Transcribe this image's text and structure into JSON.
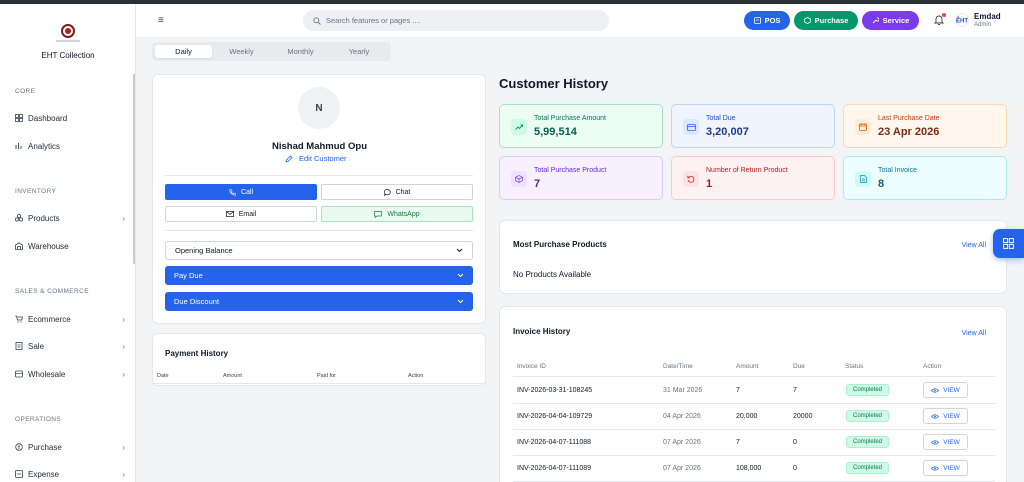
{
  "app": {
    "brand": "EHT Collection"
  },
  "sidebar": {
    "sections": [
      {
        "title": "CORE",
        "items": [
          {
            "label": "Dashboard",
            "icon": "dashboard-icon"
          },
          {
            "label": "Analytics",
            "icon": "analytics-icon"
          }
        ]
      },
      {
        "title": "INVENTORY",
        "items": [
          {
            "label": "Products",
            "icon": "products-icon",
            "expandable": true
          },
          {
            "label": "Warehouse",
            "icon": "warehouse-icon"
          }
        ]
      },
      {
        "title": "SALES & COMMERCE",
        "items": [
          {
            "label": "Ecommerce",
            "icon": "cart-icon",
            "expandable": true
          },
          {
            "label": "Sale",
            "icon": "sale-icon",
            "expandable": true
          },
          {
            "label": "Wholesale",
            "icon": "wholesale-icon",
            "expandable": true
          }
        ]
      },
      {
        "title": "OPERATIONS",
        "items": [
          {
            "label": "Purchase",
            "icon": "purchase-icon",
            "expandable": true
          },
          {
            "label": "Expense",
            "icon": "expense-icon",
            "expandable": true
          }
        ]
      }
    ]
  },
  "header": {
    "search_placeholder": "Search features or pages ....",
    "buttons": {
      "pos": "POS",
      "purchase": "Purchase",
      "service": "Service"
    },
    "user": {
      "name": "Emdad",
      "role": "Admin"
    }
  },
  "tabs": [
    "Daily",
    "Weekly",
    "Monthly",
    "Yearly"
  ],
  "active_tab": "Daily",
  "profile": {
    "initial": "N",
    "name": "Nishad Mahmud Opu",
    "edit_label": "Edit Customer",
    "actions": {
      "call": "Call",
      "chat": "Chat",
      "email": "Email",
      "whatsapp": "WhatsApp"
    },
    "dropdowns": {
      "opening_balance": "Opening Balance",
      "pay_due": "Pay Due",
      "due_discount": "Due Discount"
    }
  },
  "payment_history": {
    "title": "Payment History",
    "columns": [
      "Date",
      "Amount",
      "Paid for",
      "Action"
    ]
  },
  "customer_history": {
    "title": "Customer History",
    "stats": [
      {
        "label": "Total Purchase Amount",
        "value": "5,99,514",
        "icon": "trend-up-icon"
      },
      {
        "label": "Total Due",
        "value": "3,20,007",
        "icon": "card-icon"
      },
      {
        "label": "Last Purchase Date",
        "value": "23 Apr 2026",
        "icon": "calendar-icon"
      },
      {
        "label": "Total Purchase Product",
        "value": "7",
        "icon": "box-icon"
      },
      {
        "label": "Number of Return Product",
        "value": "1",
        "icon": "return-icon"
      },
      {
        "label": "Total Invoice",
        "value": "8",
        "icon": "document-icon"
      }
    ]
  },
  "most_purchased": {
    "title": "Most Purchase Products",
    "view_all": "View All",
    "empty": "No Products Available"
  },
  "invoice_history": {
    "title": "Invoice History",
    "view_all": "View All",
    "columns": [
      "Invoice ID",
      "Date/Time",
      "Amount",
      "Due",
      "Status",
      "Action"
    ],
    "rows": [
      {
        "id": "INV-2026-03-31-108245",
        "date": "31 Mar 2026",
        "amount": "7",
        "due": "7",
        "status": "Completed",
        "action": "VIEW"
      },
      {
        "id": "INV-2026-04-04-109729",
        "date": "04 Apr 2026",
        "amount": "20,000",
        "due": "20000",
        "status": "Completed",
        "action": "VIEW"
      },
      {
        "id": "INV-2026-04-07-111088",
        "date": "07 Apr 2026",
        "amount": "7",
        "due": "0",
        "status": "Completed",
        "action": "VIEW"
      },
      {
        "id": "INV-2026-04-07-111089",
        "date": "07 Apr 2026",
        "amount": "108,000",
        "due": "0",
        "status": "Completed",
        "action": "VIEW"
      }
    ]
  },
  "colors": {
    "primary": "#2563eb",
    "pos": "#2563eb",
    "purchase": "#059669",
    "service": "#7c3aed"
  }
}
